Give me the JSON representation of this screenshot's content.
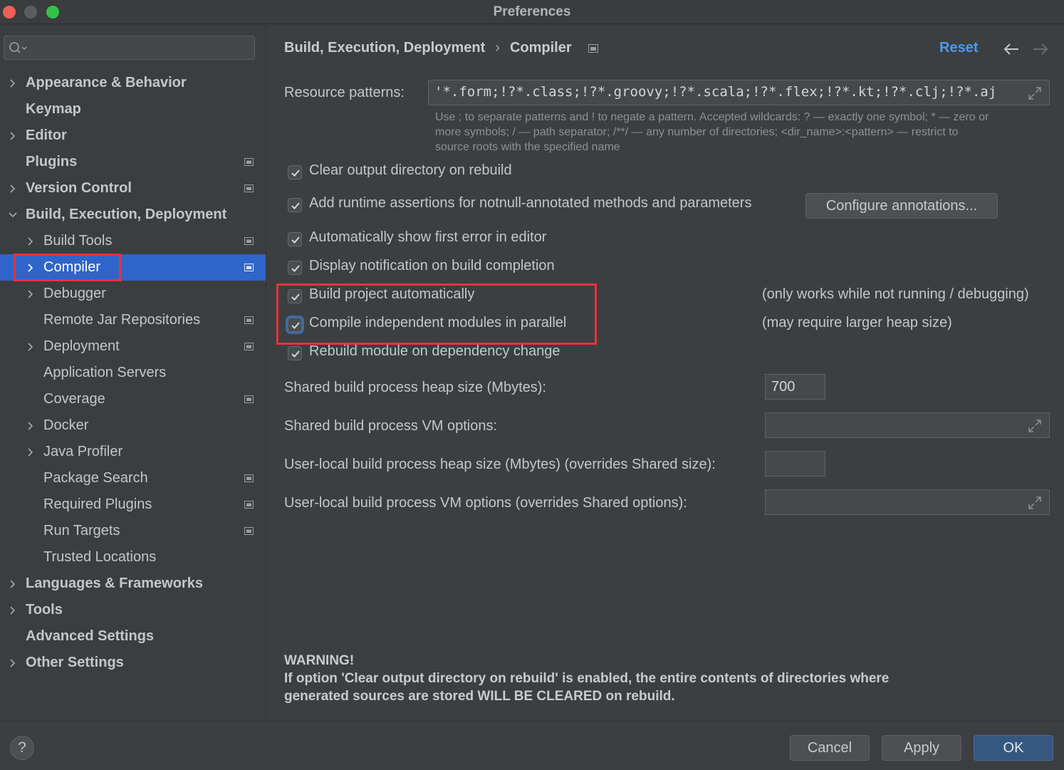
{
  "window": {
    "title": "Preferences"
  },
  "search": {
    "placeholder": "",
    "value": ""
  },
  "sidebar": {
    "items": [
      {
        "label": "Appearance & Behavior",
        "level": 0,
        "chevron": true,
        "project": false
      },
      {
        "label": "Keymap",
        "level": 0,
        "chevron": false,
        "project": false
      },
      {
        "label": "Editor",
        "level": 0,
        "chevron": true,
        "project": false
      },
      {
        "label": "Plugins",
        "level": 0,
        "chevron": false,
        "project": true
      },
      {
        "label": "Version Control",
        "level": 0,
        "chevron": true,
        "project": true
      },
      {
        "label": "Build, Execution, Deployment",
        "level": 0,
        "chevron": "down",
        "project": false
      },
      {
        "label": "Build Tools",
        "level": 1,
        "chevron": true,
        "project": true
      },
      {
        "label": "Compiler",
        "level": 1,
        "chevron": true,
        "project": true,
        "selected": true
      },
      {
        "label": "Debugger",
        "level": 1,
        "chevron": true,
        "project": false
      },
      {
        "label": "Remote Jar Repositories",
        "level": 1,
        "chevron": false,
        "project": true
      },
      {
        "label": "Deployment",
        "level": 1,
        "chevron": true,
        "project": true
      },
      {
        "label": "Application Servers",
        "level": 1,
        "chevron": false,
        "project": false
      },
      {
        "label": "Coverage",
        "level": 1,
        "chevron": false,
        "project": true
      },
      {
        "label": "Docker",
        "level": 1,
        "chevron": true,
        "project": false
      },
      {
        "label": "Java Profiler",
        "level": 1,
        "chevron": true,
        "project": false
      },
      {
        "label": "Package Search",
        "level": 1,
        "chevron": false,
        "project": true
      },
      {
        "label": "Required Plugins",
        "level": 1,
        "chevron": false,
        "project": true
      },
      {
        "label": "Run Targets",
        "level": 1,
        "chevron": false,
        "project": true
      },
      {
        "label": "Trusted Locations",
        "level": 1,
        "chevron": false,
        "project": false
      },
      {
        "label": "Languages & Frameworks",
        "level": 0,
        "chevron": true,
        "project": false
      },
      {
        "label": "Tools",
        "level": 0,
        "chevron": true,
        "project": false
      },
      {
        "label": "Advanced Settings",
        "level": 0,
        "chevron": false,
        "project": false
      },
      {
        "label": "Other Settings",
        "level": 0,
        "chevron": true,
        "project": false
      }
    ]
  },
  "header": {
    "crumb_parent": "Build, Execution, Deployment",
    "crumb_separator": "›",
    "crumb_current": "Compiler",
    "reset_label": "Reset"
  },
  "resource": {
    "label": "Resource patterns:",
    "value": "'*.form;!?*.class;!?*.groovy;!?*.scala;!?*.flex;!?*.kt;!?*.clj;!?*.aj",
    "hint_line1": "Use ; to separate patterns and ! to negate a pattern. Accepted wildcards: ? — exactly one symbol; * — zero or",
    "hint_line2": "more symbols; / — path separator; /**/ — any number of directories; <dir_name>:<pattern> — restrict to",
    "hint_line3": "source roots with the specified name"
  },
  "options": {
    "clear_output": {
      "label": "Clear output directory on rebuild",
      "checked": true
    },
    "runtime_assertions": {
      "label": "Add runtime assertions for notnull-annotated methods and parameters",
      "checked": true
    },
    "configure_label": "Configure annotations...",
    "show_first_error": {
      "label": "Automatically show first error in editor",
      "checked": true
    },
    "display_notification": {
      "label": "Display notification on build completion",
      "checked": true
    },
    "build_auto": {
      "label": "Build project automatically",
      "checked": true,
      "note": "(only works while not running / debugging)"
    },
    "compile_parallel": {
      "label": "Compile independent modules in parallel",
      "checked": true,
      "note": "(may require larger heap size)"
    },
    "rebuild_module": {
      "label": "Rebuild module on dependency change",
      "checked": true
    }
  },
  "process": {
    "shared_heap_label": "Shared build process heap size (Mbytes):",
    "shared_heap_value": "700",
    "shared_vm_label": "Shared build process VM options:",
    "shared_vm_value": "",
    "local_heap_label": "User-local build process heap size (Mbytes) (overrides Shared size):",
    "local_heap_value": "",
    "local_vm_label": "User-local build process VM options (overrides Shared options):",
    "local_vm_value": ""
  },
  "warning": {
    "title": "WARNING!",
    "line1": "If option 'Clear output directory on rebuild' is enabled, the entire contents of directories where",
    "line2": "generated sources are stored WILL BE CLEARED on rebuild."
  },
  "footer": {
    "help_label": "?",
    "cancel_label": "Cancel",
    "apply_label": "Apply",
    "ok_label": "OK"
  },
  "colors": {
    "selection": "#2f65ca",
    "accent_link": "#4a9bf0",
    "highlight": "#e8333b",
    "ok_button": "#365880"
  }
}
